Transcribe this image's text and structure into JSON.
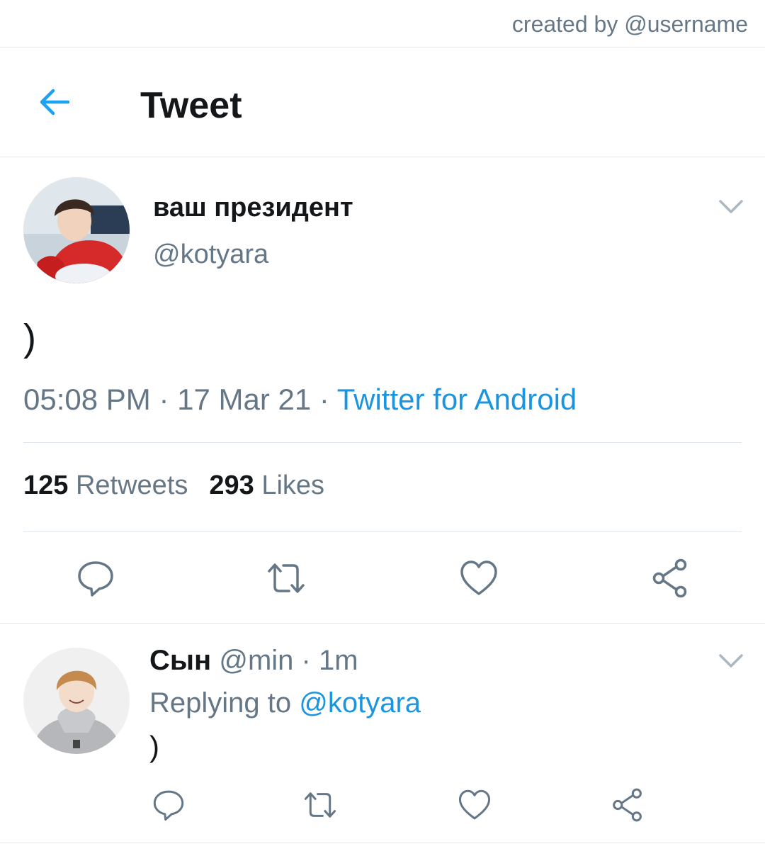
{
  "credit": "created by @username",
  "header": {
    "title": "Tweet"
  },
  "tweet": {
    "display_name": "ваш президент",
    "handle": "@kotyara",
    "text": ")",
    "time": "05:08 PM",
    "date": "17 Mar 21",
    "source": "Twitter for Android",
    "retweets_count": "125",
    "retweets_label": "Retweets",
    "likes_count": "293",
    "likes_label": "Likes"
  },
  "reply": {
    "display_name": "Сын",
    "handle": "@min",
    "time": "1m",
    "replying_label": "Replying to",
    "replying_handle": "@kotyara",
    "text": ")"
  },
  "icons": {
    "back": "arrow-left-icon",
    "menu": "chevron-down-icon",
    "reply": "speech-bubble-icon",
    "retweet": "retweet-icon",
    "like": "heart-icon",
    "share": "share-icon"
  },
  "colors": {
    "accent": "#1da1f2",
    "link": "#1b95e0",
    "muted": "#657786",
    "text": "#14171a"
  }
}
